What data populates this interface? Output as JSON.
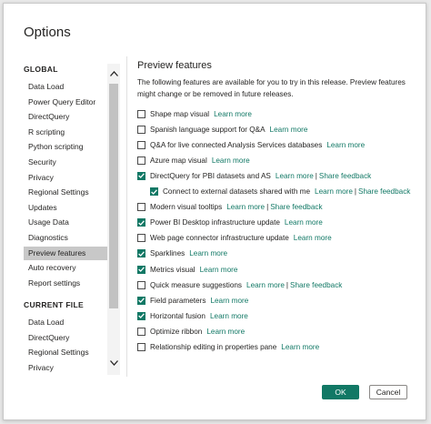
{
  "dialog": {
    "title": "Options"
  },
  "nav": {
    "global_label": "GLOBAL",
    "global_items": [
      "Data Load",
      "Power Query Editor",
      "DirectQuery",
      "R scripting",
      "Python scripting",
      "Security",
      "Privacy",
      "Regional Settings",
      "Updates",
      "Usage Data",
      "Diagnostics",
      "Preview features",
      "Auto recovery",
      "Report settings"
    ],
    "selected": "Preview features",
    "current_label": "CURRENT FILE",
    "current_items": [
      "Data Load",
      "DirectQuery",
      "Regional Settings",
      "Privacy"
    ]
  },
  "main": {
    "title": "Preview features",
    "description": "The following features are available for you to try in this release. Preview features might change or be removed in future releases.",
    "features": [
      {
        "label": "Shape map visual",
        "checked": false,
        "learn": "Learn more"
      },
      {
        "label": "Spanish language support for Q&A",
        "checked": false,
        "learn": "Learn more"
      },
      {
        "label": "Q&A for live connected Analysis Services databases",
        "checked": false,
        "learn": "Learn more"
      },
      {
        "label": "Azure map visual",
        "checked": false,
        "learn": "Learn more"
      },
      {
        "label": "DirectQuery for PBI datasets and AS",
        "checked": true,
        "learn": "Learn more",
        "feedback": "Share feedback"
      },
      {
        "label": "Connect to external datasets shared with me",
        "checked": true,
        "learn": "Learn more",
        "feedback": "Share feedback",
        "sub": true
      },
      {
        "label": "Modern visual tooltips",
        "checked": false,
        "learn": "Learn more",
        "feedback": "Share feedback"
      },
      {
        "label": "Power BI Desktop infrastructure update",
        "checked": true,
        "learn": "Learn more"
      },
      {
        "label": "Web page connector infrastructure update",
        "checked": false,
        "learn": "Learn more"
      },
      {
        "label": "Sparklines",
        "checked": true,
        "learn": "Learn more"
      },
      {
        "label": "Metrics visual",
        "checked": true,
        "learn": "Learn more"
      },
      {
        "label": "Quick measure suggestions",
        "checked": false,
        "learn": "Learn more",
        "feedback": "Share feedback"
      },
      {
        "label": "Field parameters",
        "checked": true,
        "learn": "Learn more"
      },
      {
        "label": "Horizontal fusion",
        "checked": true,
        "learn": "Learn more"
      },
      {
        "label": "Optimize ribbon",
        "checked": false,
        "learn": "Learn more"
      },
      {
        "label": "Relationship editing in properties pane",
        "checked": false,
        "learn": "Learn more"
      }
    ]
  },
  "buttons": {
    "ok": "OK",
    "cancel": "Cancel"
  },
  "colors": {
    "accent": "#117865",
    "selected_bg": "#c8c8c8"
  }
}
